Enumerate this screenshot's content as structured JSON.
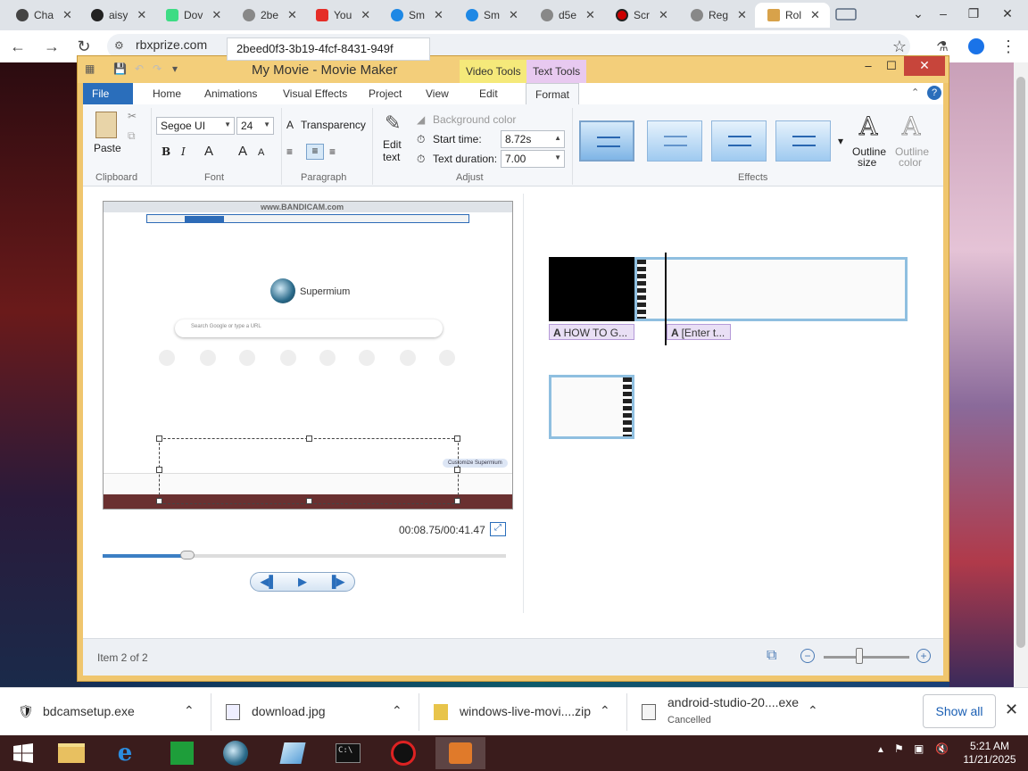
{
  "browser": {
    "tabs": [
      {
        "label": "Cha",
        "icon": "openai-icon"
      },
      {
        "label": "aisy",
        "icon": "github-icon"
      },
      {
        "label": "Dov",
        "icon": "android-icon"
      },
      {
        "label": "2be",
        "icon": "page-icon"
      },
      {
        "label": "You",
        "icon": "youtube-icon"
      },
      {
        "label": "Sm",
        "icon": "edge-icon"
      },
      {
        "label": "Sm",
        "icon": "edge-icon"
      },
      {
        "label": "d5e",
        "icon": "page-icon"
      },
      {
        "label": "Scr",
        "icon": "record-icon"
      },
      {
        "label": "Reg",
        "icon": "page-icon"
      },
      {
        "label": "Rol",
        "icon": "roblox-icon"
      }
    ],
    "url": "rbxprize.com",
    "tooltip": "2beed0f3-3b19-4fcf-8431-949f"
  },
  "moviemaker": {
    "title": "My Movie - Movie Maker",
    "context_tabs": {
      "video_tools": "Video Tools",
      "text_tools": "Text Tools"
    },
    "ribbon_tabs": [
      "File",
      "Home",
      "Animations",
      "Visual Effects",
      "Project",
      "View",
      "Edit",
      "Format"
    ],
    "clipboard": {
      "paste": "Paste",
      "group": "Clipboard"
    },
    "font": {
      "family": "Segoe UI",
      "size": "24",
      "bold": "B",
      "italic": "I",
      "grow": "A",
      "shrink": "A",
      "color": "A",
      "group": "Font"
    },
    "paragraph": {
      "transparency": "Transparency",
      "group": "Paragraph"
    },
    "adjust": {
      "edit_text_1": "Edit",
      "edit_text_2": "text",
      "background_color": "Background color",
      "start_time_label": "Start time:",
      "start_time_value": "8.72s",
      "duration_label": "Text duration:",
      "duration_value": "7.00",
      "group": "Adjust"
    },
    "effects": {
      "group": "Effects",
      "outline_size_1": "Outline",
      "outline_size_2": "size",
      "outline_color_1": "Outline",
      "outline_color_2": "color"
    },
    "preview": {
      "watermark": "www.BANDICAM.com",
      "logo_text": "Supermium",
      "search_placeholder": "Search Google or type a URL",
      "customize": "Customize Supermium"
    },
    "time": "00:08.75/00:41.47",
    "seek_progress": 0.21,
    "captions": [
      "HOW TO G...",
      "[Enter t..."
    ],
    "status": "Item 2 of 2"
  },
  "downloads": {
    "items": [
      {
        "name": "bdcamsetup.exe",
        "sub": ""
      },
      {
        "name": "download.jpg",
        "sub": ""
      },
      {
        "name": "windows-live-movi....zip",
        "sub": ""
      },
      {
        "name": "android-studio-20....exe",
        "sub": "Cancelled"
      }
    ],
    "show_all": "Show all"
  },
  "taskbar": {
    "time": "5:21 AM",
    "date": "11/21/2025"
  }
}
